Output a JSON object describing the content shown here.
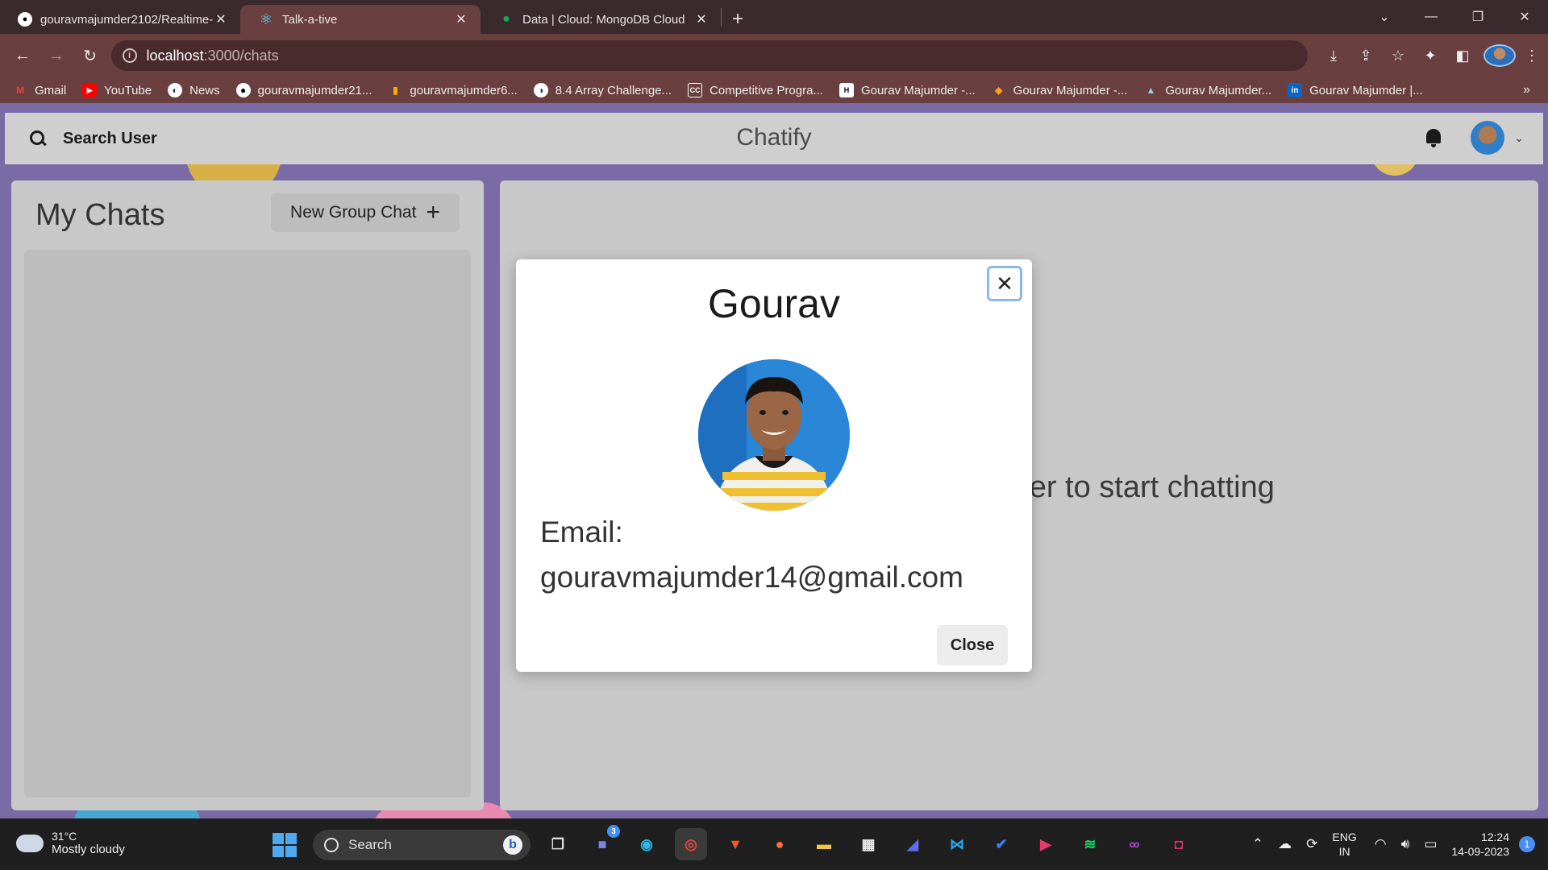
{
  "browser": {
    "tabs": [
      {
        "title": "gouravmajumder2102/Realtime-",
        "icon": "github-icon",
        "active": false
      },
      {
        "title": "Talk-a-tive",
        "icon": "react-icon",
        "active": true
      },
      {
        "title": "Data | Cloud: MongoDB Cloud",
        "icon": "mongodb-leaf-icon",
        "active": false
      }
    ],
    "new_tab": "+",
    "url_host": "localhost",
    "url_path": ":3000/chats",
    "bookmarks": [
      {
        "label": "Gmail",
        "icon": "gmail-icon"
      },
      {
        "label": "YouTube",
        "icon": "youtube-icon"
      },
      {
        "label": "News",
        "icon": "news-globe-icon"
      },
      {
        "label": "gouravmajumder21...",
        "icon": "github-icon"
      },
      {
        "label": "gouravmajumder6...",
        "icon": "analytics-icon"
      },
      {
        "label": "8.4 Array Challenge...",
        "icon": "globe-icon"
      },
      {
        "label": "Competitive Progra...",
        "icon": "codechef-icon"
      },
      {
        "label": "Gourav Majumder -...",
        "icon": "hackerrank-icon"
      },
      {
        "label": "Gourav Majumder -...",
        "icon": "leetcode-icon"
      },
      {
        "label": "Gourav Majumder...",
        "icon": "codestudio-icon"
      },
      {
        "label": "Gourav Majumder |...",
        "icon": "linkedin-icon"
      }
    ],
    "bookmarks_more": "»"
  },
  "app": {
    "search_label": "Search User",
    "title": "Chatify",
    "my_chats": "My Chats",
    "new_group": "New Group Chat",
    "chat_hint": "Click on a user to start chatting"
  },
  "modal": {
    "name": "Gourav",
    "email_label": "Email:",
    "email": "gouravmajumder14@gmail.com",
    "close": "Close",
    "close_x": "✕"
  },
  "taskbar": {
    "temp": "31°C",
    "weather": "Mostly cloudy",
    "search": "Search",
    "teams_badge": "3",
    "lang_top": "ENG",
    "lang_bottom": "IN",
    "time": "12:24",
    "date": "14-09-2023",
    "notif_count": "1"
  },
  "colors": {
    "accent": "#8cb8e8",
    "tab_active": "#6a3f40",
    "page_bg": "#7a6aa6"
  }
}
